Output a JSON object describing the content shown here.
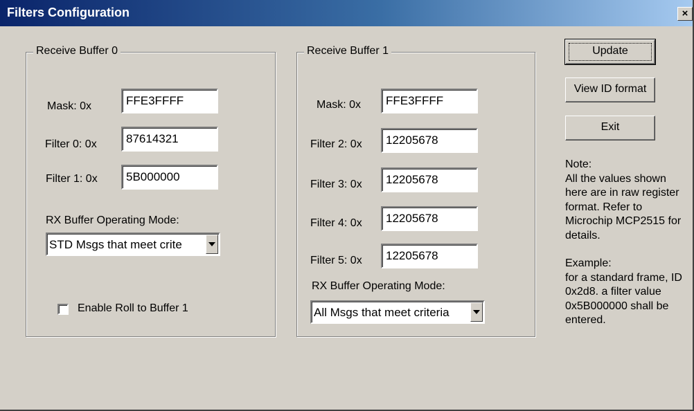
{
  "window": {
    "title": "Filters Configuration",
    "close_label": "×"
  },
  "buffer0": {
    "legend": "Receive Buffer 0",
    "mask_label": "Mask:  0x",
    "mask_value": "FFE3FFFF",
    "filter0_label": "Filter 0: 0x",
    "filter0_value": "87614321",
    "filter1_label": "Filter 1: 0x",
    "filter1_value": "5B000000",
    "mode_label": "RX Buffer Operating Mode:",
    "mode_value": "STD Msgs that meet crite",
    "rollover_label": "Enable Roll to Buffer 1",
    "rollover_checked": false
  },
  "buffer1": {
    "legend": "Receive Buffer 1",
    "mask_label": "Mask:  0x",
    "mask_value": "FFE3FFFF",
    "filter2_label": "Filter 2: 0x",
    "filter2_value": "12205678",
    "filter3_label": "Filter 3: 0x",
    "filter3_value": "12205678",
    "filter4_label": "Filter 4: 0x",
    "filter4_value": "12205678",
    "filter5_label": "Filter 5: 0x",
    "filter5_value": "12205678",
    "mode_label": "RX Buffer Operating Mode:",
    "mode_value": "All Msgs that meet criteria"
  },
  "buttons": {
    "update": "Update",
    "view_id": "View ID format",
    "exit": "Exit"
  },
  "note": {
    "paragraph1": "Note:\nAll the values shown here are in raw register format. Refer to Microchip MCP2515 for details.",
    "paragraph2": "Example:\nfor a standard frame, ID 0x2d8.  a filter value 0x5B000000 shall be entered."
  },
  "icons": {
    "close": "close-icon",
    "dropdown": "chevron-down-icon"
  }
}
